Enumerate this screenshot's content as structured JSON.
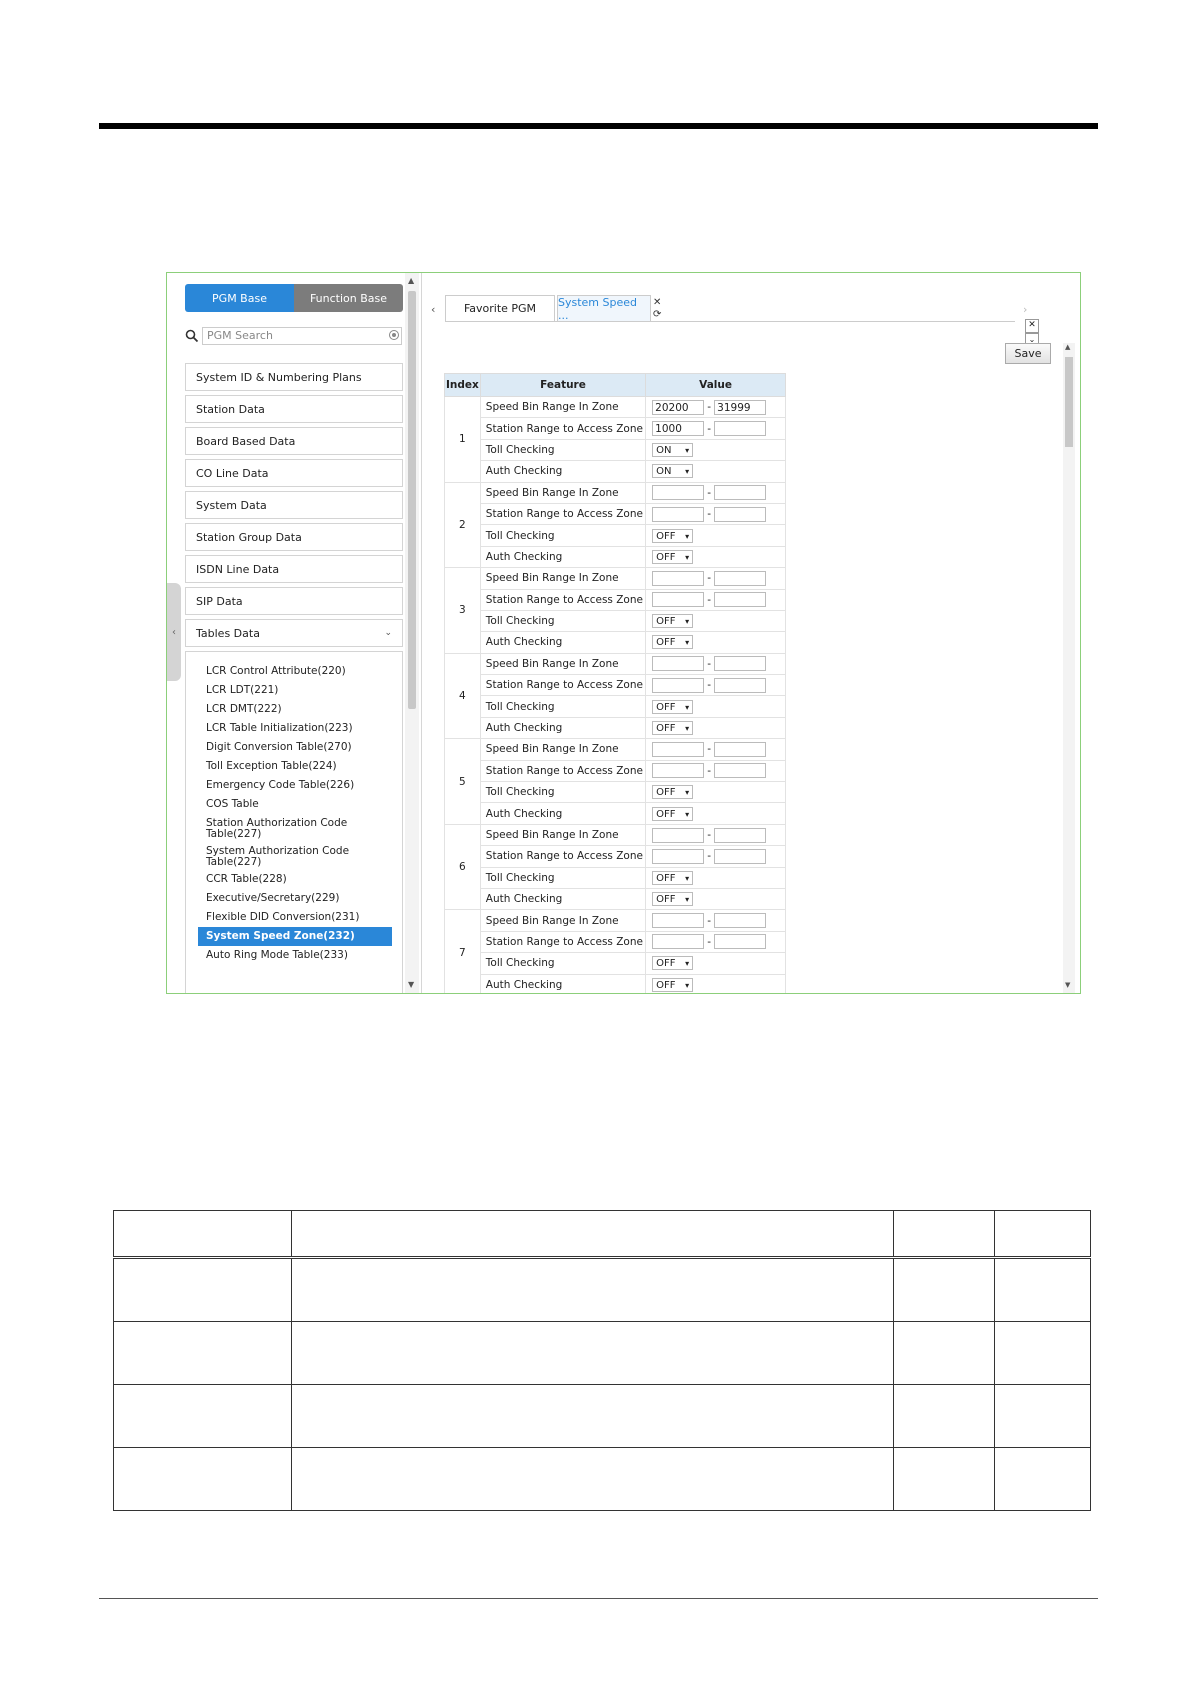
{
  "left_panel": {
    "tabs": [
      {
        "label": "PGM Base"
      },
      {
        "label": "Function Base"
      }
    ],
    "search": {
      "placeholder": "PGM Search"
    },
    "menu": [
      {
        "label": "System ID & Numbering Plans"
      },
      {
        "label": "Station Data"
      },
      {
        "label": "Board Based Data"
      },
      {
        "label": "CO Line Data"
      },
      {
        "label": "System Data"
      },
      {
        "label": "Station Group Data"
      },
      {
        "label": "ISDN Line Data"
      },
      {
        "label": "SIP Data"
      },
      {
        "label": "Tables Data"
      }
    ],
    "submenu": [
      {
        "label": "LCR Control Attribute(220)"
      },
      {
        "label": "LCR LDT(221)"
      },
      {
        "label": "LCR DMT(222)"
      },
      {
        "label": "LCR Table Initialization(223)"
      },
      {
        "label": "Digit Conversion Table(270)"
      },
      {
        "label": "Toll Exception Table(224)"
      },
      {
        "label": "Emergency Code Table(226)"
      },
      {
        "label": "COS Table"
      },
      {
        "label": "Station Authorization Code"
      },
      {
        "label": "Table(227)"
      },
      {
        "label": "System Authorization Code"
      },
      {
        "label": "Table(227)"
      },
      {
        "label": "CCR Table(228)"
      },
      {
        "label": "Executive/Secretary(229)"
      },
      {
        "label": "Flexible DID Conversion(231)"
      },
      {
        "label": "System Speed Zone(232)"
      },
      {
        "label": "Auto Ring Mode Table(233)"
      }
    ]
  },
  "right_panel": {
    "tabs": [
      {
        "label": "Favorite PGM"
      },
      {
        "label": "System Speed ..."
      }
    ],
    "save_label": "Save",
    "columns": [
      "Index",
      "Feature",
      "Value"
    ],
    "rows": [
      {
        "index": "1",
        "fields": [
          {
            "feature": "Speed Bin Range In Zone",
            "type": "range",
            "from": "20200",
            "to": "31999"
          },
          {
            "feature": "Station Range to Access Zone",
            "type": "range",
            "from": "1000",
            "to": ""
          },
          {
            "feature": "Toll Checking",
            "type": "select",
            "value": "ON"
          },
          {
            "feature": "Auth Checking",
            "type": "select",
            "value": "ON"
          }
        ]
      },
      {
        "index": "2",
        "fields": [
          {
            "feature": "Speed Bin Range In Zone",
            "type": "range",
            "from": "",
            "to": ""
          },
          {
            "feature": "Station Range to Access Zone",
            "type": "range",
            "from": "",
            "to": ""
          },
          {
            "feature": "Toll Checking",
            "type": "select",
            "value": "OFF"
          },
          {
            "feature": "Auth Checking",
            "type": "select",
            "value": "OFF"
          }
        ]
      },
      {
        "index": "3",
        "fields": [
          {
            "feature": "Speed Bin Range In Zone",
            "type": "range",
            "from": "",
            "to": ""
          },
          {
            "feature": "Station Range to Access Zone",
            "type": "range",
            "from": "",
            "to": ""
          },
          {
            "feature": "Toll Checking",
            "type": "select",
            "value": "OFF"
          },
          {
            "feature": "Auth Checking",
            "type": "select",
            "value": "OFF"
          }
        ]
      },
      {
        "index": "4",
        "fields": [
          {
            "feature": "Speed Bin Range In Zone",
            "type": "range",
            "from": "",
            "to": ""
          },
          {
            "feature": "Station Range to Access Zone",
            "type": "range",
            "from": "",
            "to": ""
          },
          {
            "feature": "Toll Checking",
            "type": "select",
            "value": "OFF"
          },
          {
            "feature": "Auth Checking",
            "type": "select",
            "value": "OFF"
          }
        ]
      },
      {
        "index": "5",
        "fields": [
          {
            "feature": "Speed Bin Range In Zone",
            "type": "range",
            "from": "",
            "to": ""
          },
          {
            "feature": "Station Range to Access Zone",
            "type": "range",
            "from": "",
            "to": ""
          },
          {
            "feature": "Toll Checking",
            "type": "select",
            "value": "OFF"
          },
          {
            "feature": "Auth Checking",
            "type": "select",
            "value": "OFF"
          }
        ]
      },
      {
        "index": "6",
        "fields": [
          {
            "feature": "Speed Bin Range In Zone",
            "type": "range",
            "from": "",
            "to": ""
          },
          {
            "feature": "Station Range to Access Zone",
            "type": "range",
            "from": "",
            "to": ""
          },
          {
            "feature": "Toll Checking",
            "type": "select",
            "value": "OFF"
          },
          {
            "feature": "Auth Checking",
            "type": "select",
            "value": "OFF"
          }
        ]
      },
      {
        "index": "7",
        "fields": [
          {
            "feature": "Speed Bin Range In Zone",
            "type": "range",
            "from": "",
            "to": ""
          },
          {
            "feature": "Station Range to Access Zone",
            "type": "range",
            "from": "",
            "to": ""
          },
          {
            "feature": "Toll Checking",
            "type": "select",
            "value": "OFF"
          },
          {
            "feature": "Auth Checking",
            "type": "select",
            "value": "OFF"
          }
        ]
      }
    ]
  },
  "colors": {
    "accent": "#2a87d8",
    "frame_border": "#8ccf7a",
    "header_bg": "#dceaf5"
  }
}
